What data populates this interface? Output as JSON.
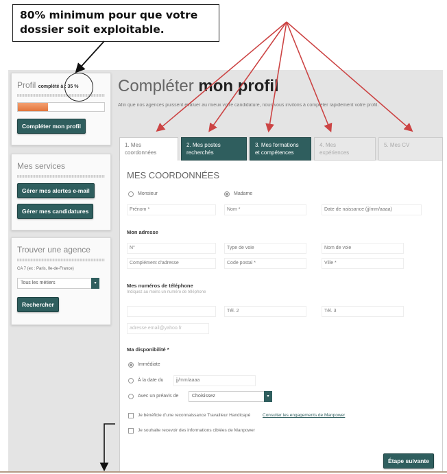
{
  "annotation": {
    "callout_line1": "80% minimum pour que votre",
    "callout_line2": "dossier soit exploitable."
  },
  "sidebar": {
    "profile": {
      "label_prefix": "Profil",
      "label_complete": "complété à : 35 %",
      "progress": 0.35,
      "button": "Compléter mon profil"
    },
    "services": {
      "title": "Mes services",
      "buttons": [
        "Gérer mes alertes e-mail",
        "Gérer mes candidatures"
      ]
    },
    "agency": {
      "title": "Trouver une agence",
      "location": "CA 7 (ex : Paris, Ile-de-France)",
      "select": "Tous les métiers",
      "button": "Rechercher"
    }
  },
  "main": {
    "title_light": "Compléter",
    "title_bold": "mon profil",
    "intro": "Afin que nos agences puissent évaluer au mieux votre candidature, nous vous invitons à compléter rapidement votre profil.",
    "tabs": [
      {
        "line1": "1. Mes",
        "line2": "coordonnées"
      },
      {
        "line1": "2. Mes postes",
        "line2": "recherchés"
      },
      {
        "line1": "3. Mes formations",
        "line2": "et compétences"
      },
      {
        "line1": "4. Mes",
        "line2": "expériences"
      },
      {
        "line1": "5. Mes CV",
        "line2": ""
      }
    ],
    "section_title": "MES COORDONNÉES",
    "civility": [
      "Monsieur",
      "Madame"
    ],
    "fields": {
      "prenom": "Prénom *",
      "nom": "Nom *",
      "naissance": "Date de naissance (jj/mm/aaaa)",
      "address_title": "Mon adresse",
      "numero": "N°",
      "type_voie": "Type de voie",
      "nom_voie": "Nom de voie",
      "complement": "Complément d'adresse",
      "code_postal": "Code postal *",
      "ville": "Ville *",
      "phones_title": "Mes numéros de téléphone",
      "phones_hint": "Indiquez au moins un numéro de téléphone",
      "tel2": "Tél. 2",
      "tel3": "Tél. 3",
      "email": "adresse.email@yahoo.fr"
    },
    "availability": {
      "title": "Ma disponibilité *",
      "opt1": "Immédiate",
      "opt2": "À la date du",
      "date_placeholder": "jj/mm/aaaa",
      "opt3": "Avec un préavis de",
      "select": "Choisissez"
    },
    "checks": {
      "handicap": "Je bénéficie d'une reconnaissance Travailleur Handicapé",
      "handicap_link": "Consulter les engagements de Manpower",
      "newsletter": "Je souhaite recevoir des informations ciblées de Manpower"
    },
    "next_button": "Étape suivante"
  },
  "colors": {
    "brand": "#2f5e5e",
    "progress": "#e2753c",
    "arrow": "#cc4444"
  }
}
